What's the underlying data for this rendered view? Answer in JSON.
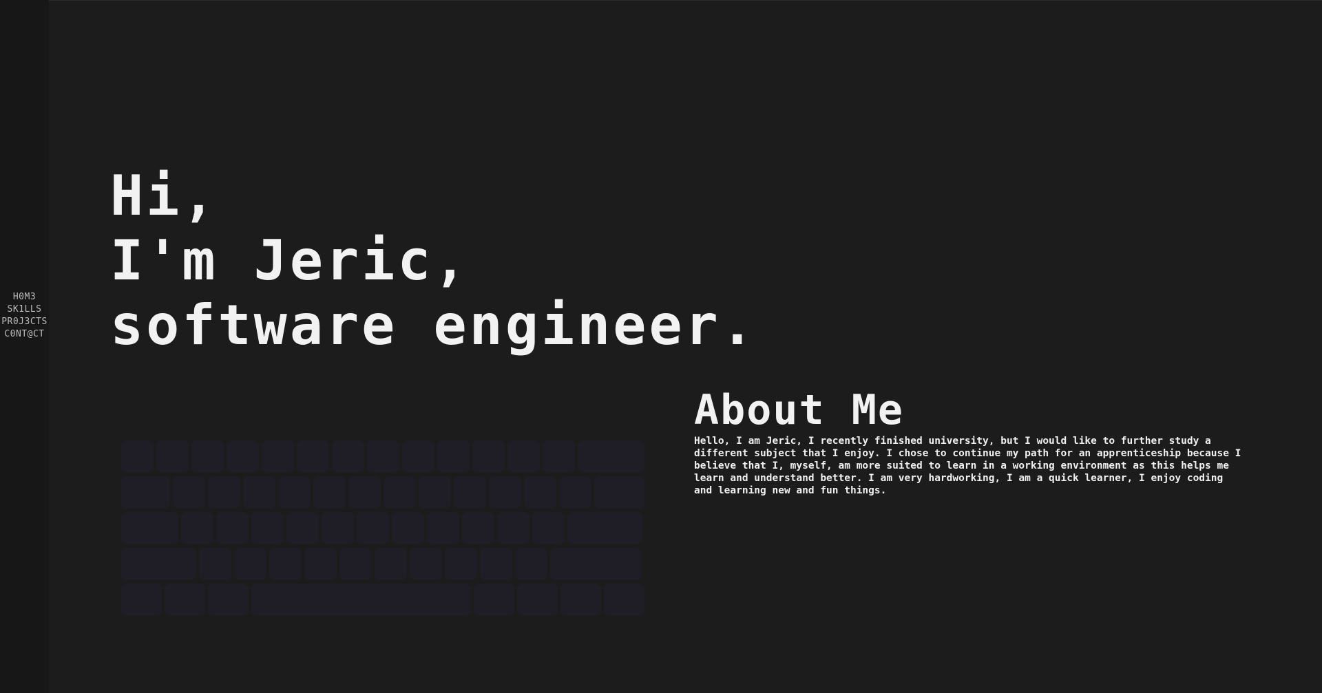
{
  "nav": {
    "items": [
      {
        "label": "H0M3"
      },
      {
        "label": "SK1LLS"
      },
      {
        "label": "PR0J3CTS"
      },
      {
        "label": "C0NT@CT"
      }
    ]
  },
  "hero": {
    "line1": "Hi,",
    "line2": "I'm Jeric,",
    "line3": "software engineer."
  },
  "about": {
    "title": "About Me",
    "text": "Hello, I am Jeric, I recently finished university, but I would like to further study a different subject that I enjoy. I chose to continue my path for an apprenticeship because I believe that I, myself, am more suited to learn in a working environment as this helps me learn and understand better. I am very hardworking, I am a quick learner, I enjoy coding and learning new and fun things."
  },
  "colors": {
    "background": "#1c1c1c",
    "sidebar": "#171717",
    "key": "#1f1e26",
    "text": "#f2f2f2",
    "nav_text": "#bdbdbd"
  }
}
